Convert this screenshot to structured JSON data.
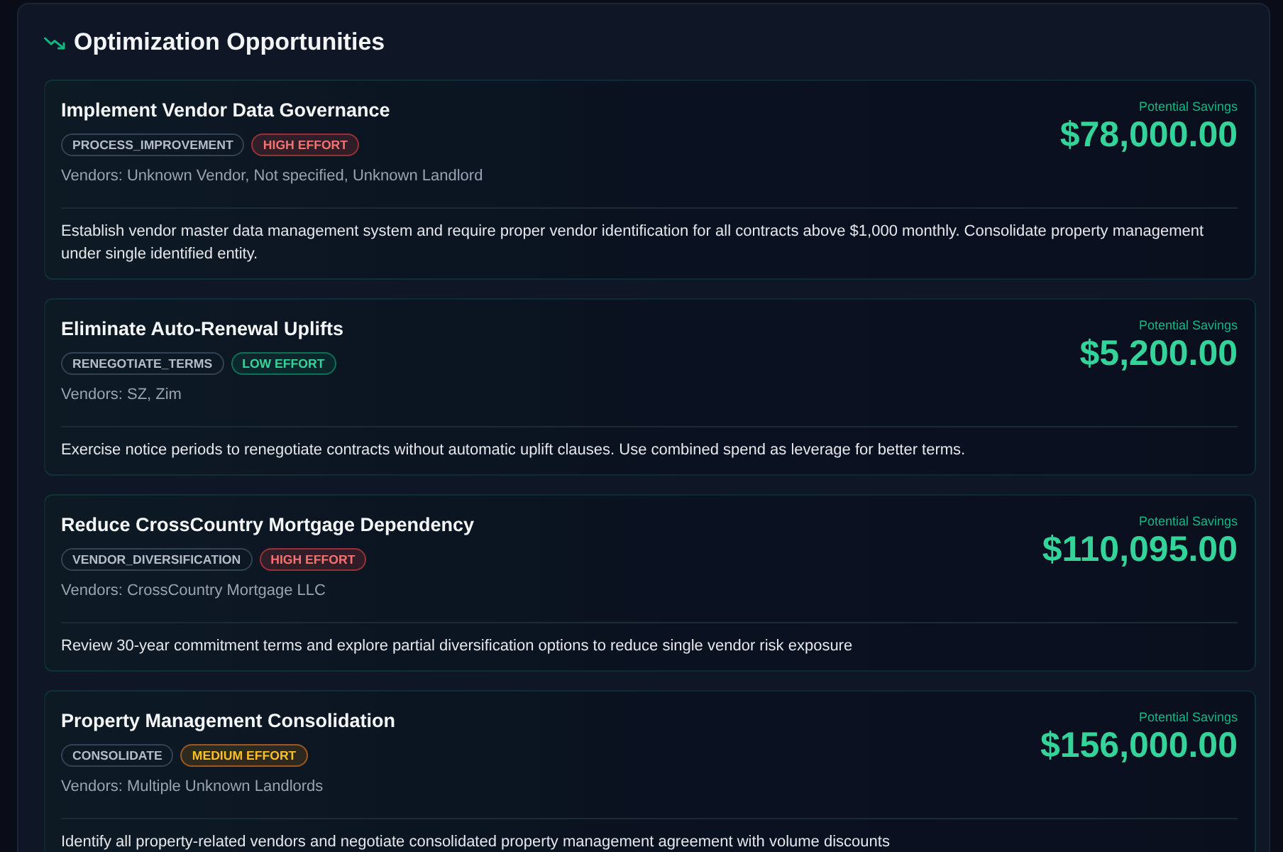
{
  "section": {
    "title": "Optimization Opportunities"
  },
  "opportunities": [
    {
      "title": "Implement Vendor Data Governance",
      "category": "PROCESS_IMPROVEMENT",
      "effort": {
        "kind": "high",
        "label": "HIGH EFFORT"
      },
      "vendors": "Vendors: Unknown Vendor, Not specified, Unknown Landlord",
      "savings_label": "Potential Savings",
      "savings": "$78,000.00",
      "description": "Establish vendor master data management system and require proper vendor identification for all contracts above $1,000 monthly. Consolidate property management under single identified entity."
    },
    {
      "title": "Eliminate Auto-Renewal Uplifts",
      "category": "RENEGOTIATE_TERMS",
      "effort": {
        "kind": "low",
        "label": "LOW EFFORT"
      },
      "vendors": "Vendors: SZ, Zim",
      "savings_label": "Potential Savings",
      "savings": "$5,200.00",
      "description": "Exercise notice periods to renegotiate contracts without automatic uplift clauses. Use combined spend as leverage for better terms."
    },
    {
      "title": "Reduce CrossCountry Mortgage Dependency",
      "category": "VENDOR_DIVERSIFICATION",
      "effort": {
        "kind": "high",
        "label": "HIGH EFFORT"
      },
      "vendors": "Vendors: CrossCountry Mortgage LLC",
      "savings_label": "Potential Savings",
      "savings": "$110,095.00",
      "description": "Review 30-year commitment terms and explore partial diversification options to reduce single vendor risk exposure"
    },
    {
      "title": "Property Management Consolidation",
      "category": "CONSOLIDATE",
      "effort": {
        "kind": "medium",
        "label": "MEDIUM EFFORT"
      },
      "vendors": "Vendors: Multiple Unknown Landlords",
      "savings_label": "Potential Savings",
      "savings": "$156,000.00",
      "description": "Identify all property-related vendors and negotiate consolidated property management agreement with volume discounts"
    }
  ]
}
